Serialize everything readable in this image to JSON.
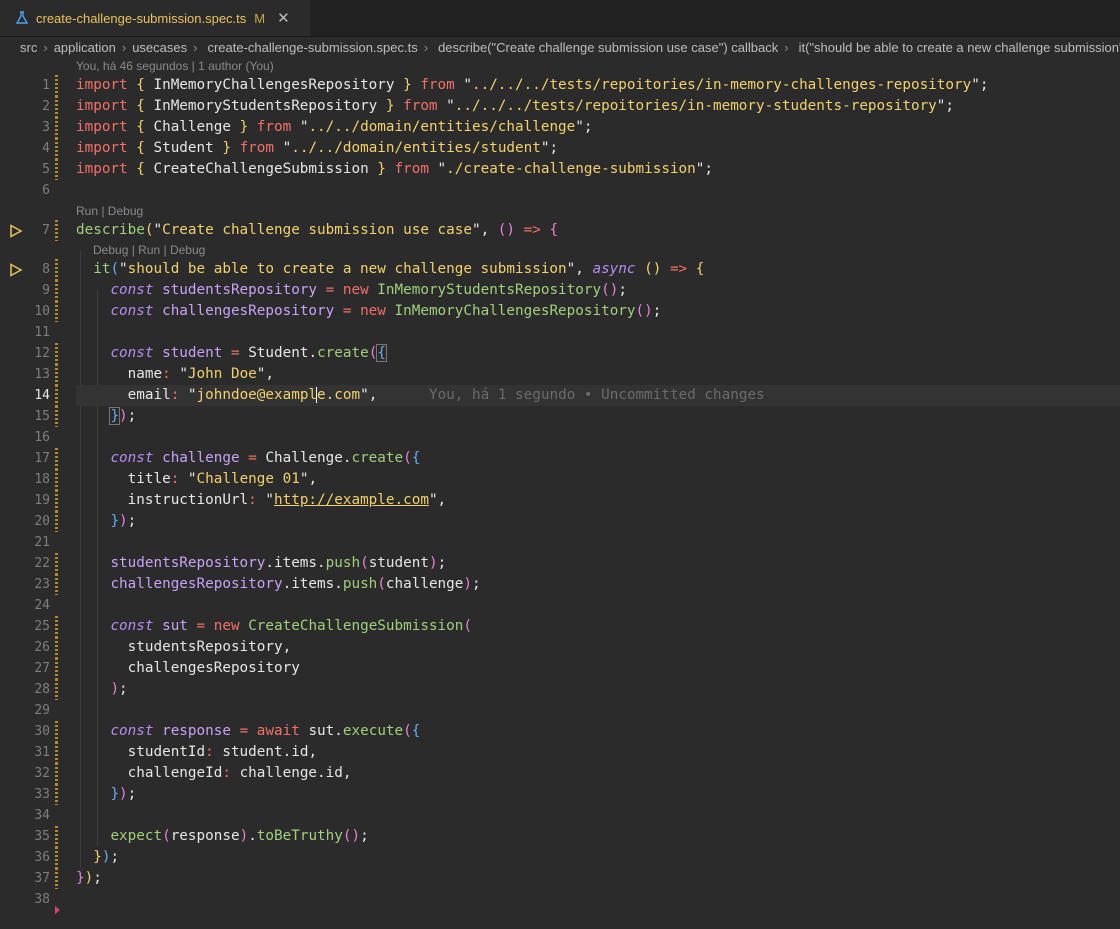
{
  "tab": {
    "filename": "create-challenge-submission.spec.ts",
    "status": "M",
    "close": "✕"
  },
  "breadcrumb": {
    "items": [
      "src",
      "application",
      "usecases",
      "create-challenge-submission.spec.ts",
      "describe(\"Create challenge submission use case\") callback",
      "it(\"should be able to create a new challenge submission\") callback"
    ]
  },
  "blame": {
    "top": "You, há 46 segundos | 1 author (You)",
    "inline": "You, há 1 segundo • Uncommitted changes"
  },
  "codelens": {
    "describe": "Run | Debug",
    "it": "Debug | Run | Debug"
  },
  "line_numbers": [
    "1",
    "2",
    "3",
    "4",
    "5",
    "6",
    "7",
    "8",
    "9",
    "10",
    "11",
    "12",
    "13",
    "14",
    "15",
    "16",
    "17",
    "18",
    "19",
    "20",
    "21",
    "22",
    "23",
    "24",
    "25",
    "26",
    "27",
    "28",
    "29",
    "30",
    "31",
    "32",
    "33",
    "34",
    "35",
    "36",
    "37",
    "38"
  ],
  "code": {
    "imports": [
      {
        "kw": "import",
        "name": "InMemoryChallengesRepository",
        "from": "from",
        "path": "../../../tests/repoitories/in-memory-challenges-repository"
      },
      {
        "kw": "import",
        "name": "InMemoryStudentsRepository",
        "from": "from",
        "path": "../../../tests/repoitories/in-memory-students-repository"
      },
      {
        "kw": "import",
        "name": "Challenge",
        "from": "from",
        "path": "../../domain/entities/challenge"
      },
      {
        "kw": "import",
        "name": "Student",
        "from": "from",
        "path": "../../domain/entities/student"
      },
      {
        "kw": "import",
        "name": "CreateChallengeSubmission",
        "from": "from",
        "path": "./create-challenge-submission"
      }
    ],
    "describe_fn": "describe",
    "describe_title": "Create challenge submission use case",
    "it_fn": "it",
    "it_title": "should be able to create a new challenge submission",
    "async_kw": "async",
    "const_kw": "const",
    "new_kw": "new",
    "await_kw": "await",
    "v_studentsRepository": "studentsRepository",
    "v_challengesRepository": "challengesRepository",
    "cls_students_repo": "InMemoryStudentsRepository",
    "cls_challenges_repo": "InMemoryChallengesRepository",
    "v_student": "student",
    "cls_student": "Student",
    "create_fn": "create",
    "prop_name": "name",
    "val_name": "John Doe",
    "prop_email": "email",
    "val_email_a": "johndoe@exampl",
    "val_email_b": "e.com",
    "v_challenge": "challenge",
    "cls_challenge": "Challenge",
    "prop_title": "title",
    "val_title": "Challenge 01",
    "prop_instructionUrl": "instructionUrl",
    "val_url": "http://example.com",
    "items_prop": "items",
    "push_fn": "push",
    "v_sut": "sut",
    "cls_use_case": "CreateChallengeSubmission",
    "v_response": "response",
    "execute_fn": "execute",
    "prop_studentId": "studentId",
    "prop_challengeId": "challengeId",
    "id_prop": "id",
    "expect_fn": "expect",
    "truthy_fn": "toBeTruthy"
  },
  "colors": {
    "background": "#2b2b2b",
    "keyword": "#f47067",
    "string": "#f2d16b",
    "function": "#9fd07b",
    "variable": "#c8a2f7"
  }
}
